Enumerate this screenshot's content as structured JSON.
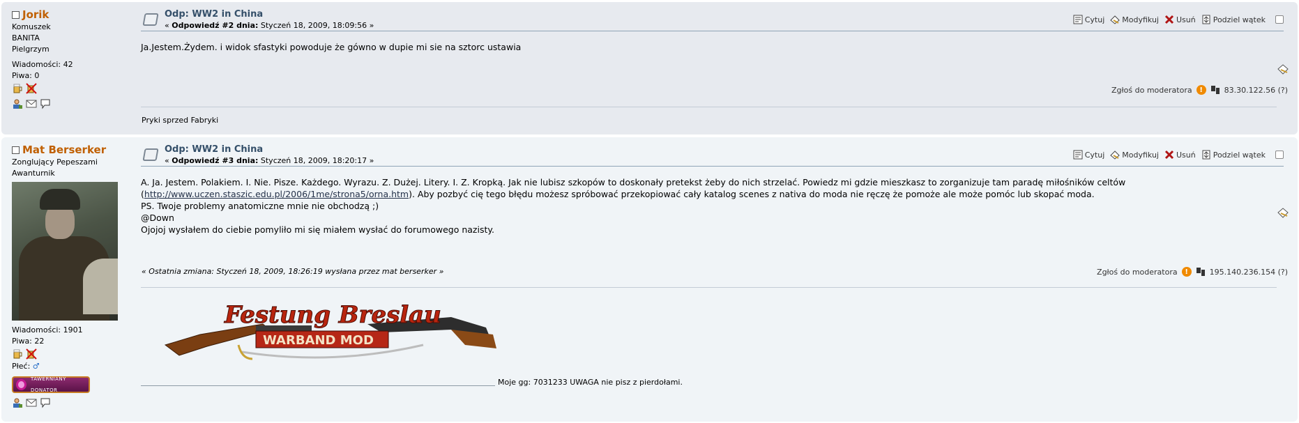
{
  "posts": [
    {
      "poster": {
        "name": "Jorik",
        "lines": [
          "Komuszek",
          "BANITA",
          "Pielgrzym"
        ],
        "posts_label": "Wiadomości: 42",
        "beers_label": "Piwa: 0"
      },
      "subject": "Odp: WW2 in China",
      "reply_prefix": "« ",
      "reply_label": "Odpowiedź #2 dnia:",
      "reply_date": " Styczeń 18, 2009, 18:09:56 »",
      "buttons": {
        "quote": "Cytuj",
        "modify": "Modyfikuj",
        "delete": "Usuń",
        "split": "Podziel wątek"
      },
      "body": "Ja.Jestem.Żydem. i widok sfastyki powoduje że gówno w dupie mi sie na sztorc ustawia",
      "report": "Zgłoś do moderatora",
      "ip": "83.30.122.56 (?)",
      "signature": "Pryki sprzed Fabryki"
    },
    {
      "poster": {
        "name": "Mat Berserker",
        "lines": [
          "Zonglujący Pepeszami",
          "Awanturnik"
        ],
        "posts_label": "Wiadomości: 1901",
        "beers_label": "Piwa: 22",
        "gender_label": "Płeć:",
        "badge_text": "TAWERNIANY DONATOR"
      },
      "subject": "Odp: WW2 in China",
      "reply_prefix": "« ",
      "reply_label": "Odpowiedź #3 dnia:",
      "reply_date": " Styczeń 18, 2009, 18:20:17 »",
      "buttons": {
        "quote": "Cytuj",
        "modify": "Modyfikuj",
        "delete": "Usuń",
        "split": "Podziel wątek"
      },
      "body_line1": "A. Ja. Jestem. Polakiem. I. Nie. Pisze. Każdego. Wyrazu. Z. Dużej. Litery. I. Z. Kropką. Jak nie lubisz szkopów to doskonały pretekst żeby do nich strzelać. Powiedz mi gdzie mieszkasz to zorganizuje tam paradę miłośników celtów",
      "body_link": "http://www.uczen.staszic.edu.pl/2006/1me/strona5/orna.htm",
      "body_line2_open": "(",
      "body_line2_rest": "). Aby pozbyć cię tego błędu możesz spróbować przekopiować cały katalog scenes z nativa do moda nie ręczę że pomoże ale może pomóc lub skopać moda.",
      "body_line3": "PS. Twoje problemy anatomiczne mnie nie obchodzą ;)",
      "body_line4": "@Down",
      "body_line5": "Ojojoj wysłałem do ciebie pomyliło mi się miałem wysłać do forumowego nazisty.",
      "last_edit": "« Ostatnia zmiana: Styczeń 18, 2009, 18:26:19 wysłana przez mat berserker »",
      "report": "Zgłoś do moderatora",
      "ip": "195.140.236.154 (?)",
      "sig_title": "Festung Breslau",
      "sig_subtitle": "WARBAND MOD",
      "signature": "Moje gg: 7031233 UWAGA nie pisz z pierdołami."
    }
  ],
  "colors": {
    "name": "#c06002",
    "subject": "#344f69",
    "post1_bg": "#e7eaef",
    "post2_bg": "#f0f4f7"
  }
}
